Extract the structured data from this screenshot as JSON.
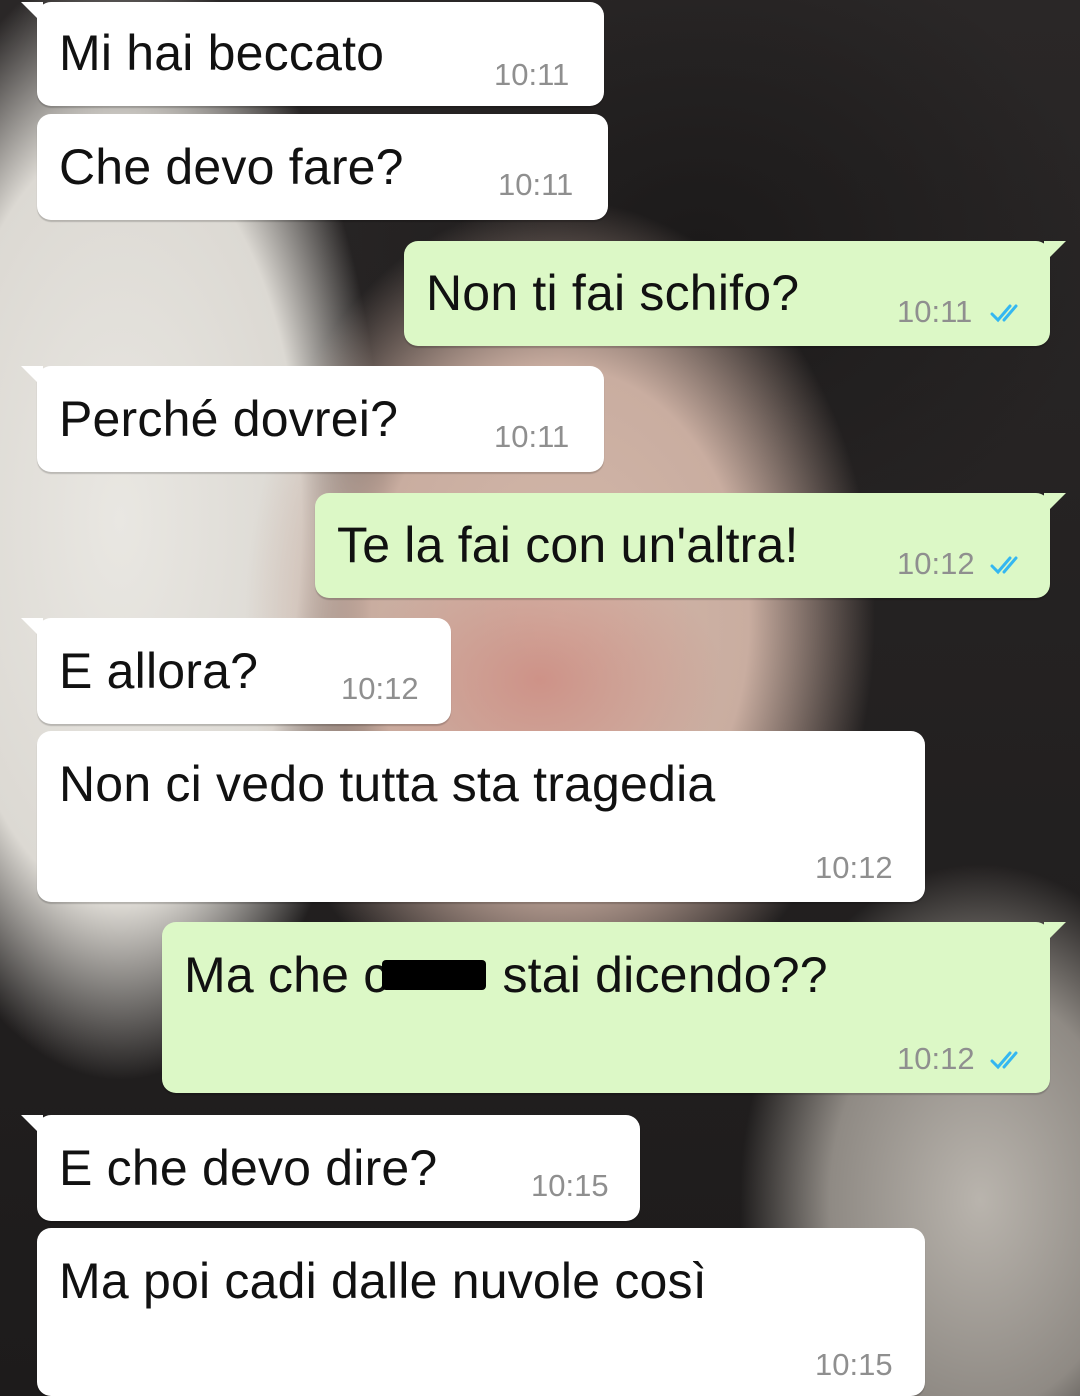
{
  "wallpaper": "woman-portrait-wallpaper",
  "colors": {
    "incoming": "#ffffff",
    "outgoing": "#dcf8c6",
    "tick": "#34b7f1",
    "time": "#8f8f8f"
  },
  "messages": [
    {
      "dir": "in",
      "text": "Mi hai beccato",
      "time": "10:11"
    },
    {
      "dir": "in",
      "text": "Che devo fare?",
      "time": "10:11"
    },
    {
      "dir": "out",
      "text": "Non ti fai schifo?",
      "time": "10:11",
      "status": "read"
    },
    {
      "dir": "in",
      "text": "Perché dovrei?",
      "time": "10:11"
    },
    {
      "dir": "out",
      "text": "Te la fai con un'altra!",
      "time": "10:12",
      "status": "read"
    },
    {
      "dir": "in",
      "text": "E allora?",
      "time": "10:12"
    },
    {
      "dir": "in",
      "text": "Non ci vedo tutta sta tragedia",
      "time": "10:12"
    },
    {
      "dir": "out",
      "text_before": "Ma che c",
      "text_after": "stai dicendo??",
      "time": "10:12",
      "status": "read",
      "redacted": true
    },
    {
      "dir": "in",
      "text": "E che devo dire?",
      "time": "10:15"
    },
    {
      "dir": "in",
      "text": "Ma poi cadi dalle nuvole così",
      "time": "10:15"
    }
  ]
}
